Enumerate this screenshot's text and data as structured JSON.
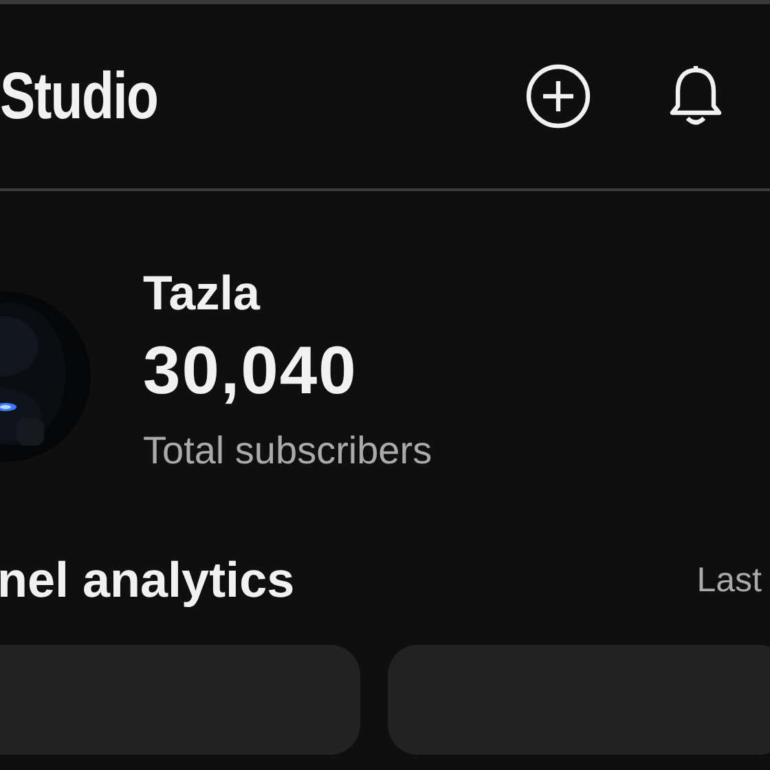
{
  "header": {
    "title": "Studio"
  },
  "channel": {
    "name": "Tazla",
    "subscribers": "30,040",
    "subscribers_label": "Total subscribers"
  },
  "analytics": {
    "title": "nel analytics",
    "period": "Last"
  }
}
